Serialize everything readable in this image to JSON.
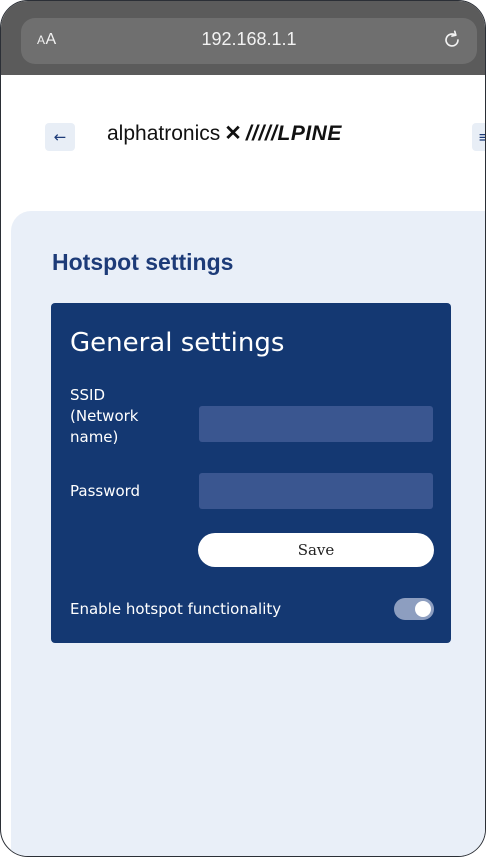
{
  "browser": {
    "text_size_label_small": "A",
    "text_size_label_large": "A",
    "url": "192.168.1.1"
  },
  "header": {
    "back_symbol": "←",
    "brand_left": "alphatronics",
    "brand_x": "✕",
    "brand_right": "/////LPINE",
    "menu_symbol": "≡"
  },
  "page": {
    "title": "Hotspot settings"
  },
  "general": {
    "title": "General settings",
    "ssid_label": "SSID\n(Network\nname)",
    "ssid_value": "",
    "password_label": "Password",
    "password_value": "",
    "save_label": "Save",
    "hotspot_toggle_label": "Enable hotspot functionality",
    "hotspot_enabled": true
  },
  "colors": {
    "card_bg": "#143872",
    "title_color": "#1d3b78",
    "content_bg": "#e9eff8"
  }
}
